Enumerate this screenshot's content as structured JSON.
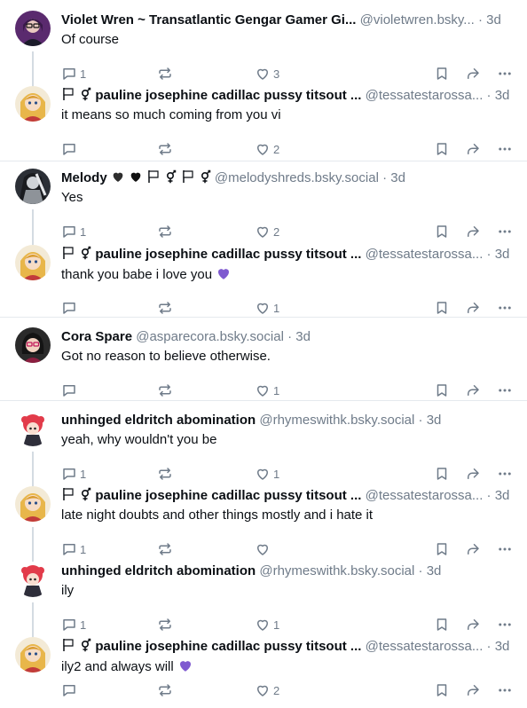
{
  "posts": [
    {
      "name": "Violet Wren ~ Transatlantic Gengar Gamer Gi...",
      "handle": "@violetwren.bsky...",
      "time": "3d",
      "text": "Of course",
      "replies": "1",
      "likes": "3",
      "avatar": "violet"
    },
    {
      "name": "pauline josephine cadillac pussy titsout ...",
      "handle": "@tessatestarossa...",
      "time": "3d",
      "text": "it means so much coming from you vi",
      "replies": "",
      "likes": "2",
      "avatar": "pauline"
    },
    {
      "name": "Melody",
      "handle": "@melodyshreds.bsky.social",
      "time": "3d",
      "text": "Yes",
      "replies": "1",
      "likes": "2",
      "avatar": "melody"
    },
    {
      "name": "pauline josephine cadillac pussy titsout ...",
      "handle": "@tessatestarossa...",
      "time": "3d",
      "text": "thank you babe i love you",
      "replies": "",
      "likes": "1",
      "avatar": "pauline"
    },
    {
      "name": "Cora Spare",
      "handle": "@asparecora.bsky.social",
      "time": "3d",
      "text": "Got no reason to believe otherwise.",
      "replies": "",
      "likes": "1",
      "avatar": "cora"
    },
    {
      "name": "unhinged eldritch abomination",
      "handle": "@rhymeswithk.bsky.social",
      "time": "3d",
      "text": "yeah, why wouldn't you be",
      "replies": "1",
      "likes": "1",
      "avatar": "unhinged"
    },
    {
      "name": "pauline josephine cadillac pussy titsout ...",
      "handle": "@tessatestarossa...",
      "time": "3d",
      "text": "late night doubts and other things mostly and i hate it",
      "replies": "1",
      "likes": "",
      "avatar": "pauline"
    },
    {
      "name": "unhinged eldritch abomination",
      "handle": "@rhymeswithk.bsky.social",
      "time": "3d",
      "text": "ily",
      "replies": "1",
      "likes": "1",
      "avatar": "unhinged"
    },
    {
      "name": "pauline josephine cadillac pussy titsout ...",
      "handle": "@tessatestarossa...",
      "time": "3d",
      "text": "ily2 and always will",
      "replies": "",
      "likes": "2",
      "avatar": "pauline"
    }
  ],
  "separator": "·",
  "colors": {
    "meta": "#6f7b89",
    "heart_emoji": "#7f5ad0",
    "divider": "#e5e9ee"
  }
}
